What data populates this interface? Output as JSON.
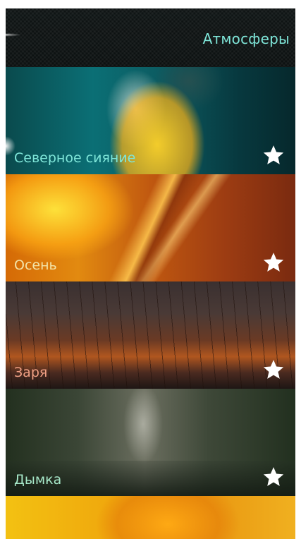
{
  "header": {
    "title": "Атмосферы"
  },
  "cards": [
    {
      "label": "Северное сияние",
      "label_color": "#7fe6d9",
      "star": "star-icon"
    },
    {
      "label": "Осень",
      "label_color": "#f3e3a8",
      "star": "star-icon"
    },
    {
      "label": "Заря",
      "label_color": "#f0a084",
      "star": "star-icon"
    },
    {
      "label": "Дымка",
      "label_color": "#a7e8c9",
      "star": "star-icon"
    }
  ]
}
